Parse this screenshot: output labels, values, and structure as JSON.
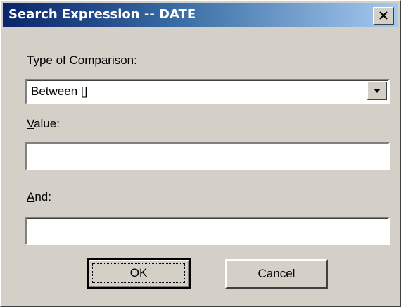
{
  "window": {
    "title": "Search Expression -- DATE"
  },
  "comparison": {
    "label_accel": "T",
    "label_rest": "ype of Comparison:",
    "selected": "Between  []"
  },
  "value": {
    "label_accel": "V",
    "label_rest": "alue:",
    "text": ""
  },
  "and": {
    "label_accel": "A",
    "label_rest": "nd:",
    "text": ""
  },
  "buttons": {
    "ok": "OK",
    "cancel": "Cancel"
  },
  "icons": {
    "close": "close-icon",
    "dropdown": "triangle-down-icon"
  },
  "colors": {
    "titlebar_start": "#0a246a",
    "titlebar_end": "#a6caf0",
    "face": "#d4d0c8"
  }
}
